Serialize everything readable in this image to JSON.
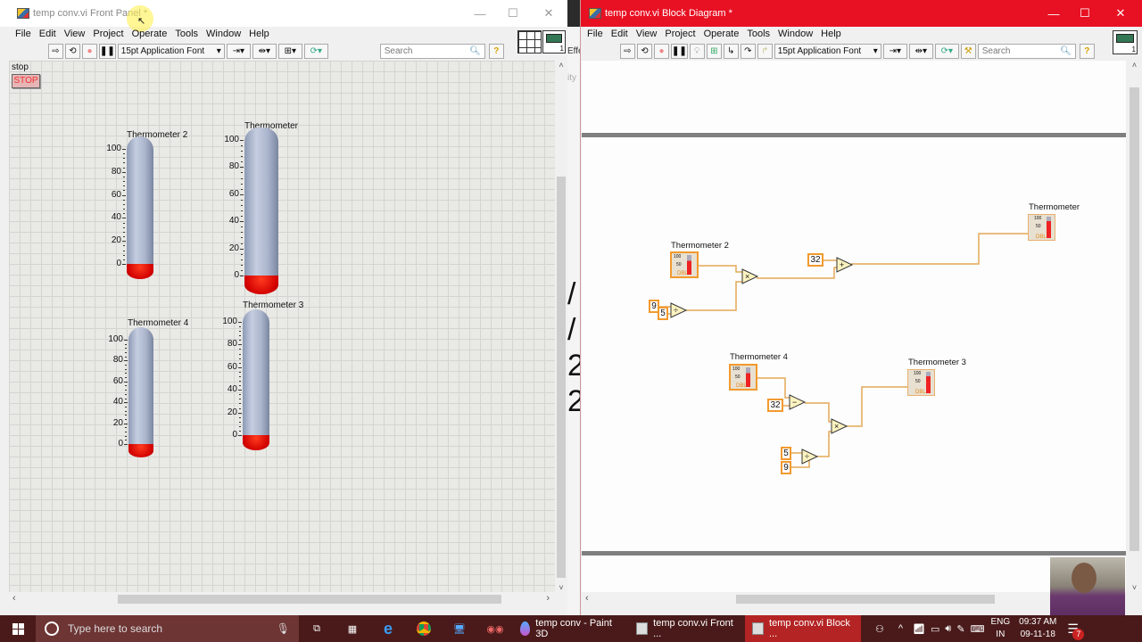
{
  "front_panel": {
    "title": "temp conv.vi Front Panel *",
    "menu": [
      "File",
      "Edit",
      "View",
      "Project",
      "Operate",
      "Tools",
      "Window",
      "Help"
    ],
    "font": "15pt Application Font",
    "search_placeholder": "Search",
    "stop_label": "stop",
    "stop_button": "STOP",
    "thermometers": [
      {
        "label": "Thermometer 2",
        "scale": [
          "100",
          "80",
          "60",
          "40",
          "20",
          "0"
        ],
        "value": 0
      },
      {
        "label": "Thermometer",
        "scale": [
          "100",
          "80",
          "60",
          "40",
          "20",
          "0"
        ],
        "value": 0
      },
      {
        "label": "Thermometer 4",
        "scale": [
          "100",
          "80",
          "60",
          "40",
          "20",
          "0"
        ],
        "value": 0
      },
      {
        "label": "Thermometer 3",
        "scale": [
          "100",
          "80",
          "60",
          "40",
          "20",
          "0"
        ],
        "value": 0
      }
    ],
    "connector_count": "1"
  },
  "block_diagram": {
    "title": "temp conv.vi Block Diagram *",
    "accent": "#e81123",
    "menu": [
      "File",
      "Edit",
      "View",
      "Project",
      "Operate",
      "Tools",
      "Window",
      "Help"
    ],
    "font": "15pt Application Font",
    "search_placeholder": "Search",
    "nodes": {
      "therm2": "Thermometer 2",
      "therm": "Thermometer",
      "therm4": "Thermometer 4",
      "therm3": "Thermometer 3",
      "dbl": "DBL",
      "scale_hi": "100",
      "scale_mid": "50"
    },
    "constants": {
      "c9a": "9",
      "c5a": "5",
      "c32a": "32",
      "c32b": "32",
      "c5b": "5",
      "c9b": "9"
    },
    "ops": {
      "mul1": "×",
      "add1": "+",
      "div1": "÷",
      "sub2": "−",
      "mul2": "×",
      "div2": "÷"
    },
    "connector_count": "1"
  },
  "background_text": "ity",
  "background_text2": "Effe",
  "taskbar": {
    "search_placeholder": "Type here to search",
    "apps": [
      {
        "label": "temp conv - Paint 3D"
      },
      {
        "label": "temp conv.vi Front ..."
      },
      {
        "label": "temp conv.vi Block ..."
      }
    ],
    "lang1": "ENG",
    "lang2": "IN",
    "time": "09:37 AM",
    "date": "09-11-18",
    "notifications": "7"
  }
}
